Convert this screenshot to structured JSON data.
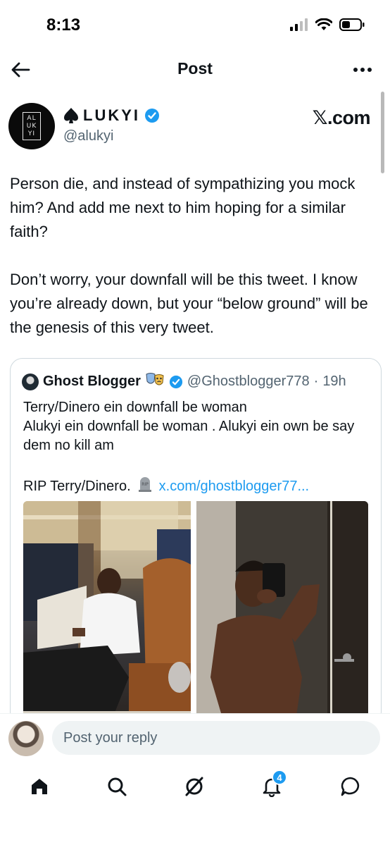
{
  "status_bar": {
    "time": "8:13"
  },
  "header": {
    "title": "Post"
  },
  "post": {
    "author": {
      "display_name": "LUKYI",
      "handle": "@alukyi",
      "avatar_logo": [
        "AL",
        "UK",
        "YI"
      ]
    },
    "source": "𝕏.com",
    "text": "Person die, and instead of sympathizing you mock him? And add me next to him hoping for a similar faith?\n\nDon’t worry, your downfall will be this tweet. I know you’re already down, but your “below ground” will be the genesis of this very tweet.",
    "quote": {
      "name": "Ghost Blogger",
      "handle": "@Ghostblogger778",
      "separator": "·",
      "time": "19h",
      "text": "Terry/Dinero ein downfall be woman\nAlukyi ein downfall be woman . Alukyi ein own be say dem no kill am",
      "rip_text": "RIP Terry/Dinero.",
      "link": "x.com/ghostblogger77..."
    }
  },
  "reply": {
    "placeholder": "Post your reply"
  },
  "tabs": {
    "notifications_badge": "4"
  },
  "colors": {
    "accent": "#1d9bf0",
    "text": "#0f1419",
    "secondary": "#536471"
  }
}
